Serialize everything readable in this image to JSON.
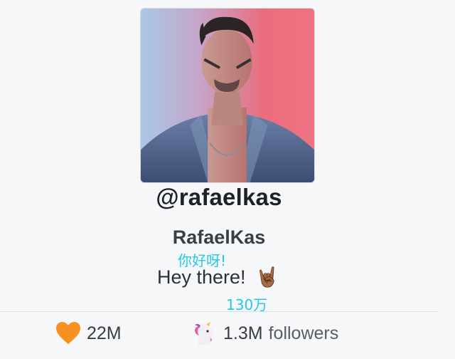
{
  "profile": {
    "handle": "@rafaelkas",
    "display_name": "RafaelKas",
    "bio": "Hey there!",
    "bio_emoji": "🤘🏾"
  },
  "overlays": {
    "greeting_cn": "你好呀!",
    "followers_cn": "130万"
  },
  "stats": {
    "likes": {
      "icon": "orange-heart-icon",
      "value": "22M"
    },
    "followers": {
      "icon": "unicorn-icon",
      "value": "1.3M",
      "label": "followers"
    }
  }
}
